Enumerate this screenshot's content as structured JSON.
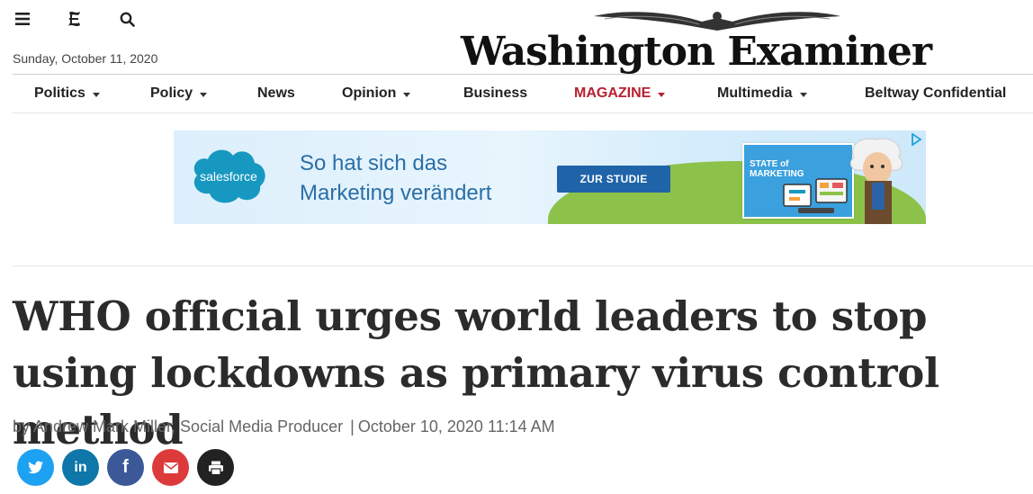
{
  "header": {
    "date": "Sunday, October 11, 2020",
    "logo_text": "Washington Examiner",
    "icons": [
      "menu-icon",
      "logo-mark-icon",
      "search-icon"
    ]
  },
  "nav": {
    "items": [
      {
        "label": "Politics",
        "dropdown": true
      },
      {
        "label": "Policy",
        "dropdown": true
      },
      {
        "label": "News",
        "dropdown": false
      },
      {
        "label": "Opinion",
        "dropdown": true
      },
      {
        "label": "Business",
        "dropdown": false
      },
      {
        "label": "MAGAZINE",
        "dropdown": true,
        "color": "#b8202f"
      },
      {
        "label": "Multimedia",
        "dropdown": true
      },
      {
        "label": "Beltway Confidential",
        "dropdown": false
      }
    ]
  },
  "ad": {
    "brand": "salesforce",
    "headline_line1": "So hat sich das",
    "headline_line2": "Marketing verändert",
    "cta": "ZUR STUDIE",
    "booklet_title_line1": "STATE of",
    "booklet_title_line2": "MARKETING",
    "colors": {
      "cloud": "#1798c1",
      "cta": "#1f64a8"
    }
  },
  "article": {
    "headline": "WHO official urges world leaders to stop using lockdowns as primary virus control method",
    "author": "by Andrew Mark Miller, Social Media Producer",
    "separator": "|",
    "timestamp": "October 10, 2020 11:14 AM"
  },
  "share": {
    "buttons": [
      "twitter-icon",
      "linkedin-icon",
      "facebook-icon",
      "email-icon",
      "print-icon"
    ],
    "linkedin_label": "in",
    "facebook_label": "f"
  }
}
